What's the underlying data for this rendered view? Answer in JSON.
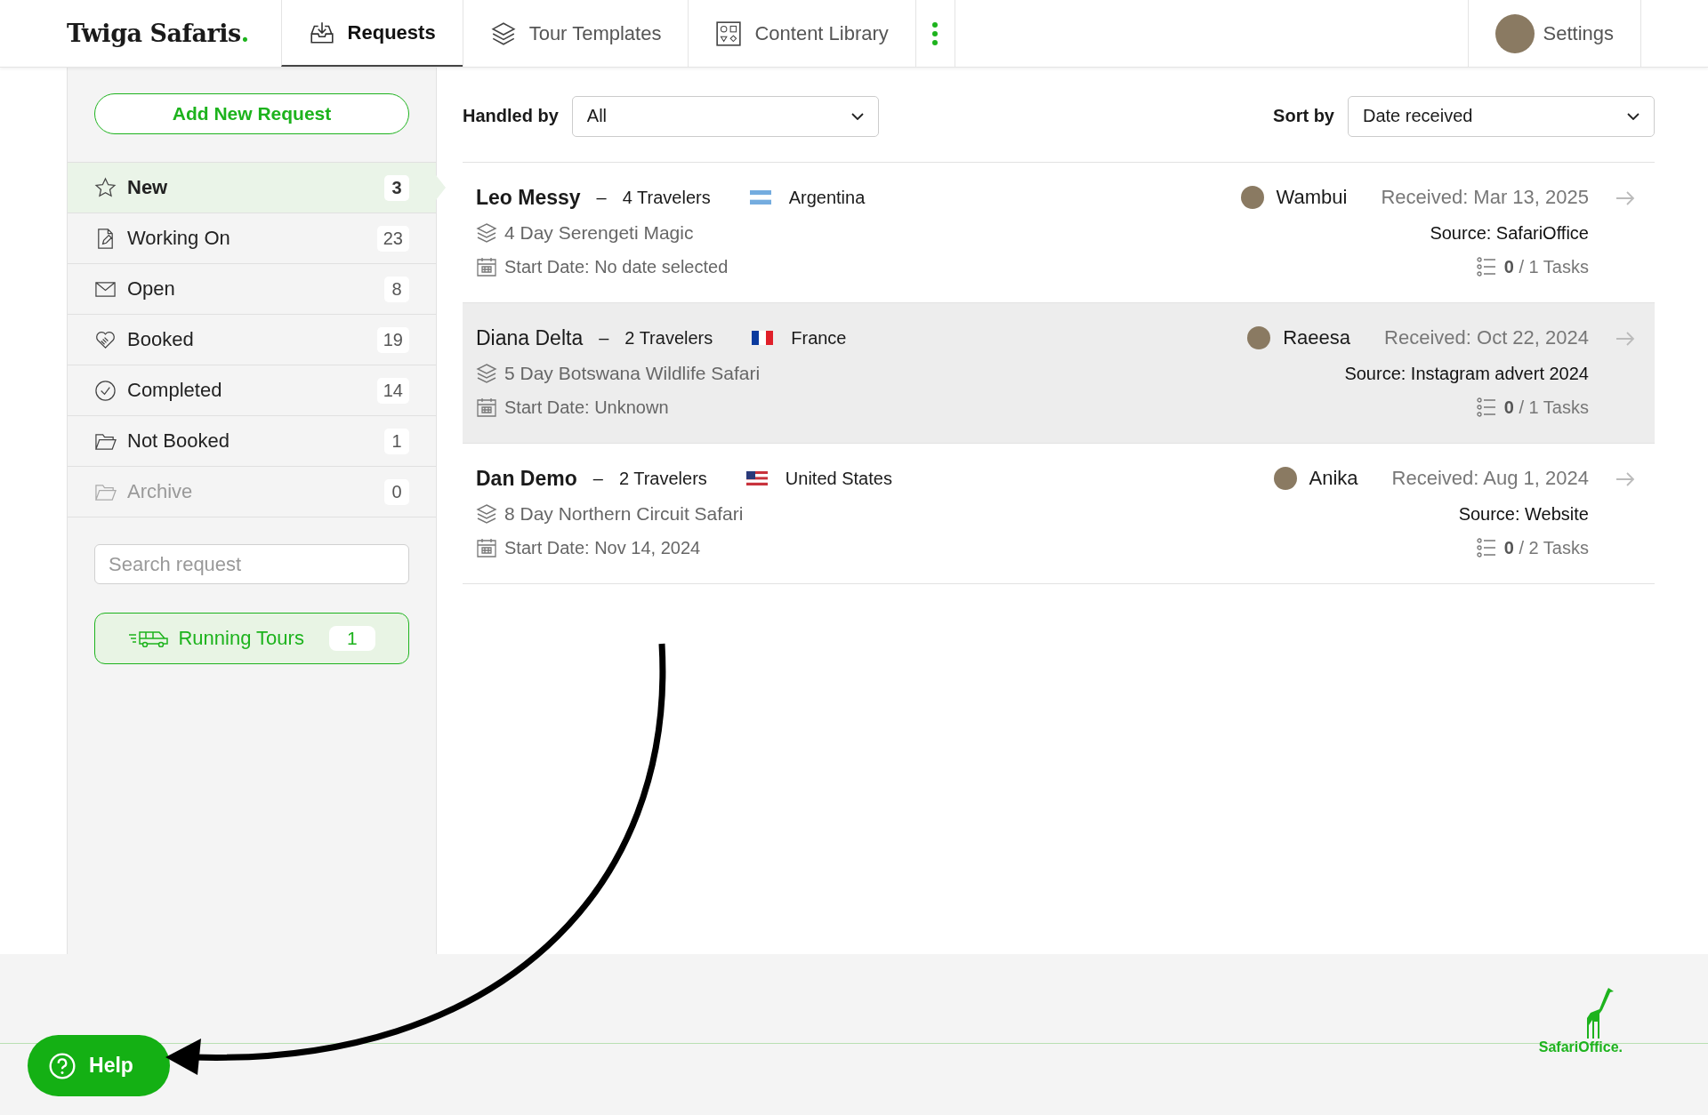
{
  "brand": {
    "name": "Twiga Safaris",
    "dot": "."
  },
  "nav": [
    {
      "label": "Requests",
      "selected": true
    },
    {
      "label": "Tour Templates",
      "selected": false
    },
    {
      "label": "Content Library",
      "selected": false
    }
  ],
  "settings": {
    "label": "Settings"
  },
  "sidebar": {
    "add_button": "Add New Request",
    "items": [
      {
        "label": "New",
        "count": "3",
        "selected": true,
        "disabled": false
      },
      {
        "label": "Working On",
        "count": "23",
        "selected": false,
        "disabled": false
      },
      {
        "label": "Open",
        "count": "8",
        "selected": false,
        "disabled": false
      },
      {
        "label": "Booked",
        "count": "19",
        "selected": false,
        "disabled": false
      },
      {
        "label": "Completed",
        "count": "14",
        "selected": false,
        "disabled": false
      },
      {
        "label": "Not Booked",
        "count": "1",
        "selected": false,
        "disabled": false
      },
      {
        "label": "Archive",
        "count": "0",
        "selected": false,
        "disabled": true
      }
    ],
    "search": {
      "placeholder": "Search request"
    },
    "running": {
      "label": "Running Tours",
      "count": "1"
    }
  },
  "filters": {
    "handled_by": {
      "label": "Handled by",
      "value": "All"
    },
    "sort_by": {
      "label": "Sort by",
      "value": "Date received"
    }
  },
  "requests": [
    {
      "name": "Leo Messy",
      "unread": true,
      "selected": false,
      "separator": "–",
      "travelers": "4 Travelers",
      "country": "Argentina",
      "tour": "4 Day Serengeti Magic",
      "start_date": "Start Date: No date selected",
      "agent": "Wambui",
      "received": "Received: Mar 13, 2025",
      "source": "Source: SafariOffice",
      "tasks_done": "0",
      "tasks_total": "/ 1 Tasks"
    },
    {
      "name": "Diana Delta",
      "unread": false,
      "selected": true,
      "separator": "–",
      "travelers": "2 Travelers",
      "country": "France",
      "tour": "5 Day Botswana Wildlife Safari",
      "start_date": "Start Date: Unknown",
      "agent": "Raeesa",
      "received": "Received: Oct 22, 2024",
      "source": "Source: Instagram advert 2024",
      "tasks_done": "0",
      "tasks_total": "/ 1 Tasks"
    },
    {
      "name": "Dan Demo",
      "unread": true,
      "selected": false,
      "separator": "–",
      "travelers": "2 Travelers",
      "country": "United States",
      "tour": "8 Day Northern Circuit Safari",
      "start_date": "Start Date: Nov 14, 2024",
      "agent": "Anika",
      "received": "Received: Aug 1, 2024",
      "source": "Source: Website",
      "tasks_done": "0",
      "tasks_total": "/ 2 Tasks"
    }
  ],
  "help": {
    "label": "Help"
  },
  "footer_logo": {
    "first": "Safari",
    "second": "Office."
  }
}
